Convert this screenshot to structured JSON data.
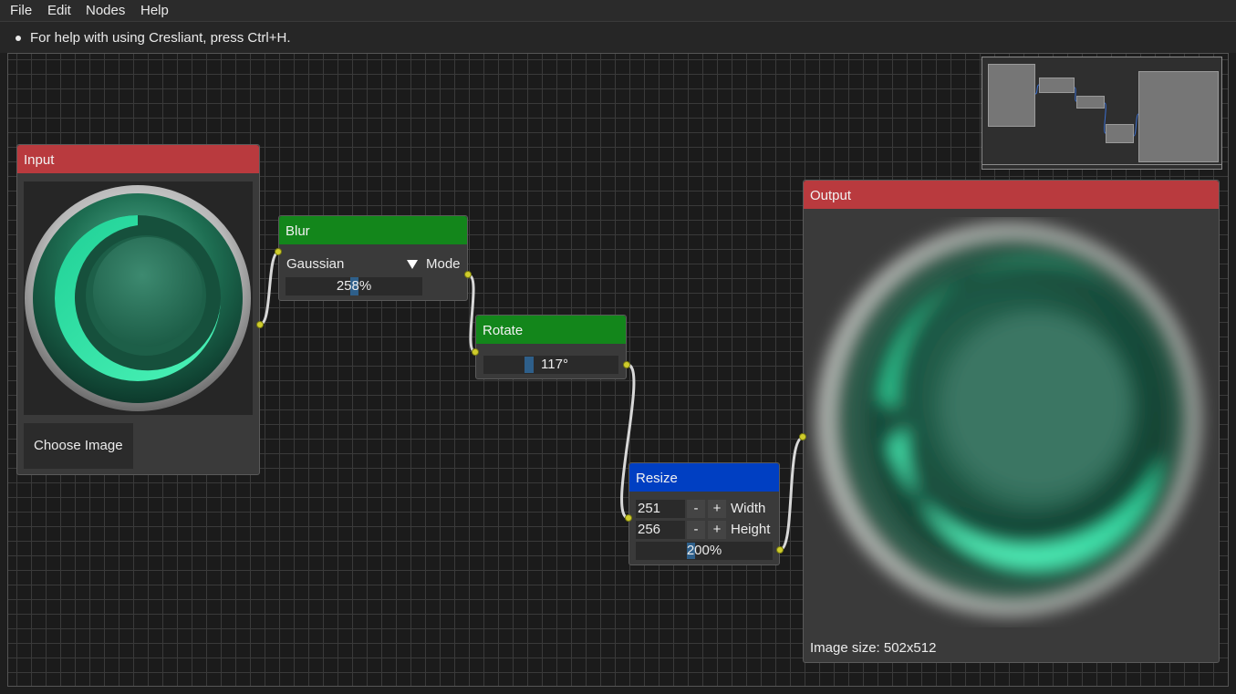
{
  "menubar": {
    "items": [
      "File",
      "Edit",
      "Nodes",
      "Help"
    ]
  },
  "help": {
    "text": "For help with using Cresliant, press Ctrl+H."
  },
  "nodes": {
    "input": {
      "title": "Input",
      "button_label": "Choose Image"
    },
    "blur": {
      "title": "Blur",
      "mode_value": "Gaussian",
      "mode_label": "Mode",
      "amount": "258%"
    },
    "rotate": {
      "title": "Rotate",
      "angle": "117°"
    },
    "resize": {
      "title": "Resize",
      "width_value": "251",
      "width_label": "Width",
      "height_value": "256",
      "height_label": "Height",
      "scale": "200%",
      "minus": "-",
      "plus": "+"
    },
    "output": {
      "title": "Output",
      "image_size": "Image size: 502x512"
    }
  },
  "colors": {
    "header_red": "#b93a3e",
    "header_green": "#13861b",
    "header_blue": "#003fc2",
    "port": "#cfcc2c",
    "accent_teal": "#2ee6a0"
  },
  "icons": {
    "dropdown": "triangle-down-icon",
    "help_bullet": "bullet-icon"
  }
}
